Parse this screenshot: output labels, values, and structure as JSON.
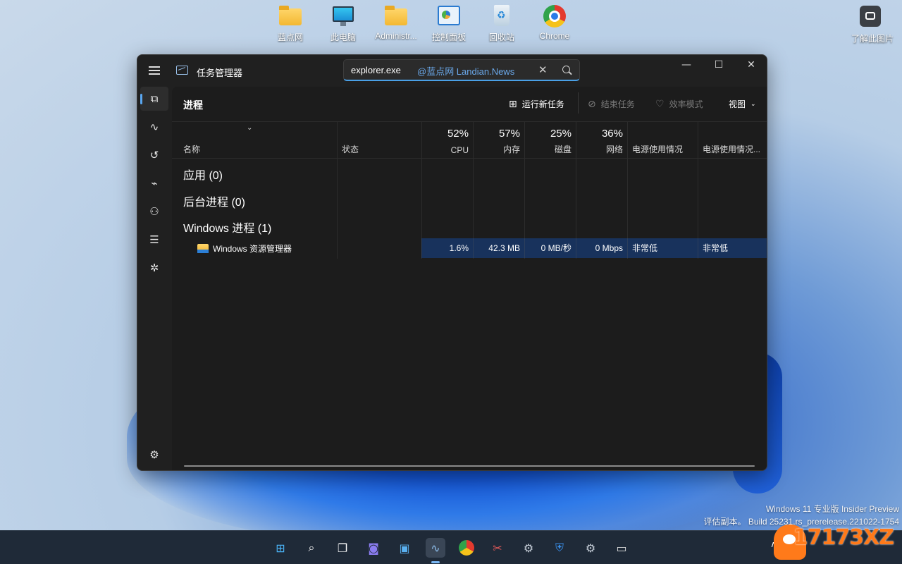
{
  "desktop": {
    "icons": [
      {
        "label": "蓝点网",
        "icon": "folder-icon"
      },
      {
        "label": "此电脑",
        "icon": "this-pc-icon"
      },
      {
        "label": "Administr...",
        "icon": "folder-icon"
      },
      {
        "label": "控制面板",
        "icon": "control-panel-icon"
      },
      {
        "label": "回收站",
        "icon": "recycle-bin-icon"
      },
      {
        "label": "Chrome",
        "icon": "chrome-icon"
      }
    ],
    "about_image_label": "了解此图片",
    "watermark_line1": "Windows 11 专业版 Insider Preview",
    "watermark_line2": "评估副本。 Build 25231.rs_prerelease.221022-1754"
  },
  "window": {
    "title": "任务管理器",
    "search": {
      "query": "explorer.exe",
      "overlay_watermark": "@蓝点网 Landian.News"
    },
    "controls": {
      "minimize": "—",
      "maximize": "☐",
      "close": "✕"
    }
  },
  "nav": [
    {
      "name": "processes",
      "icon": "processes-icon",
      "glyph": "⧉",
      "active": true
    },
    {
      "name": "performance",
      "icon": "performance-icon",
      "glyph": "∿"
    },
    {
      "name": "app-history",
      "icon": "app-history-icon",
      "glyph": "↺"
    },
    {
      "name": "startup-apps",
      "icon": "startup-icon",
      "glyph": "⌁"
    },
    {
      "name": "users",
      "icon": "users-icon",
      "glyph": "⚇"
    },
    {
      "name": "details",
      "icon": "details-icon",
      "glyph": "☰"
    },
    {
      "name": "services",
      "icon": "services-icon",
      "glyph": "✲"
    }
  ],
  "settings_glyph": "⚙",
  "page": {
    "title": "进程",
    "commands": {
      "run_new_task": "运行新任务",
      "end_task": "结束任务",
      "efficiency_mode": "效率模式",
      "view": "视图"
    }
  },
  "columns": {
    "name": "名称",
    "status": "状态",
    "cpu": {
      "pct": "52%",
      "label": "CPU"
    },
    "memory": {
      "pct": "57%",
      "label": "内存"
    },
    "disk": {
      "pct": "25%",
      "label": "磁盘"
    },
    "network": {
      "pct": "36%",
      "label": "网络"
    },
    "power": "电源使用情况",
    "power_trend": "电源使用情况..."
  },
  "groups": {
    "apps": "应用 (0)",
    "background": "后台进程 (0)",
    "windows": "Windows 进程 (1)"
  },
  "process": {
    "name": "Windows 资源管理器",
    "cpu": "1.6%",
    "memory": "42.3 MB",
    "disk": "0 MB/秒",
    "network": "0 Mbps",
    "power": "非常低",
    "power_trend": "非常低"
  },
  "taskbar": {
    "logo_text": "17173XZ"
  }
}
